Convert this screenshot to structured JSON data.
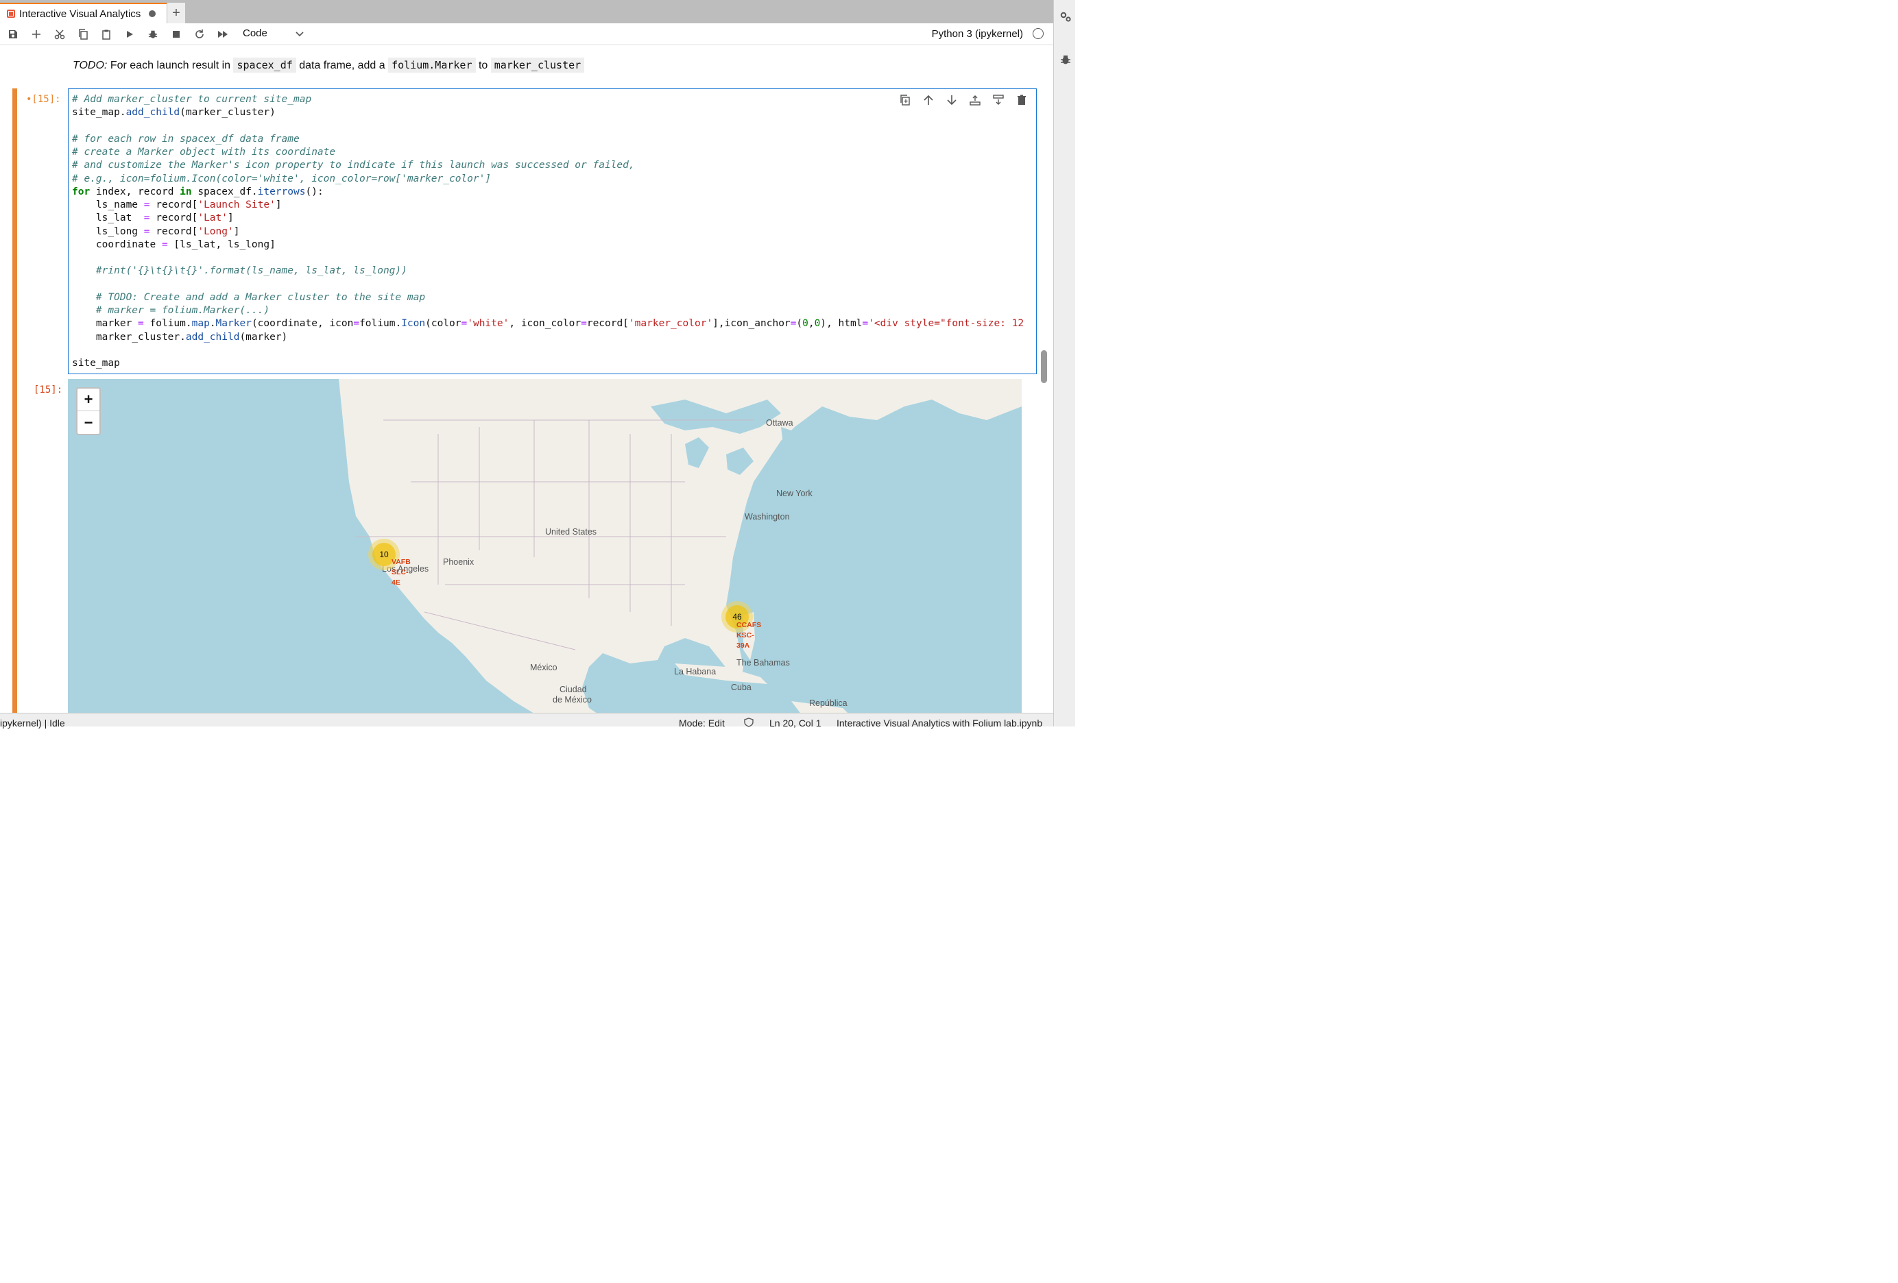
{
  "tab": {
    "title": "Interactive Visual Analytics",
    "new_tab_symbol": "+"
  },
  "toolbar": {
    "buttons": [
      "save-icon",
      "add-cell-icon",
      "cut-icon",
      "copy-icon",
      "paste-icon",
      "run-icon",
      "debug-icon",
      "stop-icon",
      "restart-icon",
      "fast-forward-icon"
    ],
    "cell_type": "Code",
    "kernel": "Python 3 (ipykernel)"
  },
  "markdown": {
    "todo": "TODO:",
    "text1": "For each launch result in",
    "code1": "spacex_df",
    "text2": "data frame, add a",
    "code2": "folium.Marker",
    "text3": "to",
    "code3": "marker_cluster"
  },
  "cell": {
    "prompt_in": "•[15]:",
    "prompt_out": "[15]:"
  },
  "map": {
    "zoom_in": "+",
    "zoom_out": "−",
    "labels": {
      "ottawa": "Ottawa",
      "new_york": "New York",
      "washington": "Washington",
      "united_states": "United States",
      "phoenix": "Phoenix",
      "los_angeles": "Los Angeles",
      "mexico": "México",
      "ciudad": "Ciudad",
      "de_mexico": "de México",
      "la_habana": "La Habana",
      "bahamas": "The Bahamas",
      "cuba": "Cuba",
      "republica": "República"
    },
    "clusters": [
      {
        "count": "10",
        "labels": [
          "VAFB",
          "SLC-",
          "4E"
        ]
      },
      {
        "count": "46",
        "labels": [
          "CCAFS",
          "KSC-",
          "39A"
        ]
      }
    ]
  },
  "status": {
    "kernel": "ipykernel) | Idle",
    "mode": "Mode: Edit",
    "position": "Ln 20, Col 1",
    "file": "Interactive Visual Analytics with Folium lab.ipynb"
  }
}
